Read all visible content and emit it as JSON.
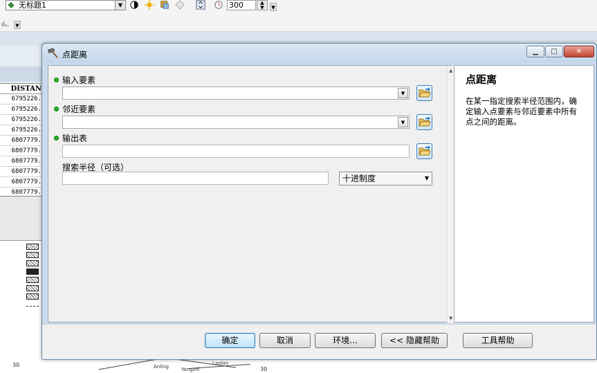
{
  "background": {
    "layer_name": "无标题1",
    "scale_value": "300",
    "table_header": "DISTAN",
    "table_values": [
      "6795226.",
      "6795226.",
      "6795226.",
      "6795226.",
      "6807779.",
      "6807779.",
      "6807779.",
      "6807779.",
      "6807779.",
      "6807779."
    ],
    "corner_labels": [
      "30",
      "30"
    ]
  },
  "dialog": {
    "title": "点距离",
    "minimize_icon": "minimize-icon",
    "maximize_icon": "maximize-icon",
    "close_icon": "close-icon",
    "fields": {
      "input_label": "输入要素",
      "near_label": "邻近要素",
      "output_label": "输出表",
      "radius_label": "搜索半径（可选）",
      "unit_value": "十进制度"
    },
    "help": {
      "title": "点距离",
      "body": "在某一指定搜索半径范围内，确定输入点要素与邻近要素中所有点之间的距离。"
    },
    "buttons": {
      "ok": "确定",
      "cancel": "取消",
      "env": "环境...",
      "hide_help": "<< 隐藏帮助",
      "tool_help": "工具帮助"
    }
  },
  "colors": {
    "required_dot": "#1fb81f",
    "title_bar": "#c9dbec"
  }
}
